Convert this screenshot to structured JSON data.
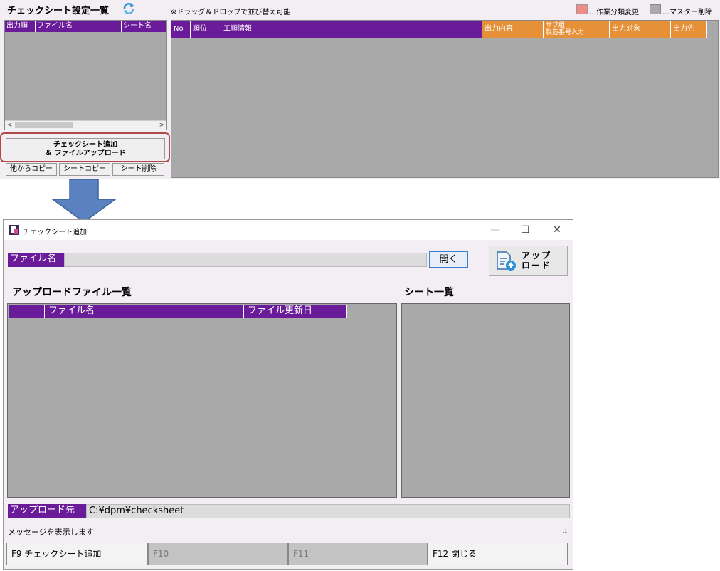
{
  "top_screen": {
    "title": "チェックシート設定一覧",
    "drag_note": "※ドラッグ＆ドロップで並び替え可能",
    "legend": {
      "category_change": "…作業分類変更",
      "master_delete": "…マスター削除",
      "category_change_color": "#f08b86",
      "master_delete_color": "#a9a9a9"
    },
    "left_grid_headers": [
      "出力順",
      "ファイル名",
      "シート名"
    ],
    "add_button": {
      "line1": "チェックシート追加",
      "line2": "＆ ファイルアップロード"
    },
    "buttons": {
      "copy_from_other": "他からコピー",
      "sheet_copy": "シートコピー",
      "sheet_delete": "シート削除"
    },
    "right_grid_headers": {
      "no": "No",
      "rank": "順位",
      "process_info": "工順情報",
      "output_content": "出力内容",
      "sub_line1": "サブ組",
      "sub_line2": "製造番号入力",
      "output_target": "出力対象",
      "output_dest": "出力先"
    }
  },
  "dialog": {
    "title": "チェックシート追加",
    "controls": {
      "minimize": "—",
      "maximize": "☐",
      "close": "✕"
    },
    "file_name_label": "ファイル名",
    "file_name_value": "",
    "open_button": "開く",
    "upload_button": {
      "line1": "アップ",
      "line2": "ロード"
    },
    "upload_file_list_title": "アップロードファイル一覧",
    "sheet_list_title": "シート一覧",
    "file_grid_headers": [
      "",
      "ファイル名",
      "ファイル更新日"
    ],
    "upload_dest_label": "アップロード先",
    "upload_dest_value": "C:¥dpm¥checksheet",
    "message": "メッセージを表示します",
    "function_keys": [
      {
        "label": "F9 チェックシート追加",
        "enabled": true
      },
      {
        "label": "F10",
        "enabled": false
      },
      {
        "label": "F11",
        "enabled": false
      },
      {
        "label": "F12 閉じる",
        "enabled": true
      }
    ]
  },
  "colors": {
    "header_purple": "#6a1b9a",
    "header_orange": "#e69138",
    "grid_gray": "#a9a9a9",
    "arrow_blue": "#5b82c0"
  }
}
